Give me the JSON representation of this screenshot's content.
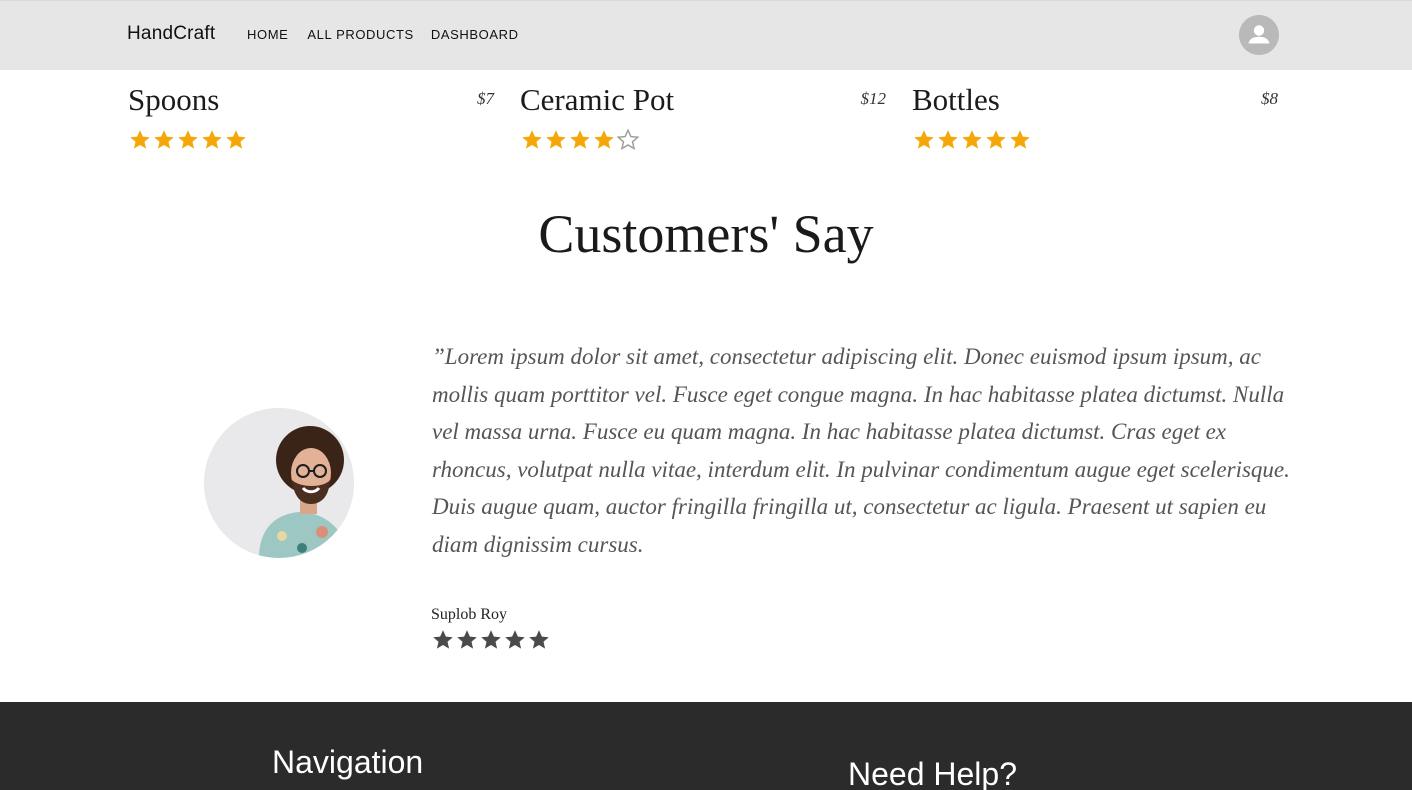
{
  "header": {
    "brand": "HandCraft",
    "nav": [
      {
        "label": "HOME"
      },
      {
        "label": "ALL PRODUCTS"
      },
      {
        "label": "DASHBOARD"
      }
    ],
    "account_icon": "account-circle-icon",
    "background": "#e6e6e6"
  },
  "products": [
    {
      "name": "Spoons",
      "price": "$7",
      "rating": 5,
      "max_rating": 5
    },
    {
      "name": "Ceramic Pot",
      "price": "$12",
      "rating": 4,
      "max_rating": 5
    },
    {
      "name": "Bottles",
      "price": "$8",
      "rating": 5,
      "max_rating": 5
    }
  ],
  "testimonials": {
    "title": "Customers' Say",
    "quote": "”Lorem ipsum dolor sit amet, consectetur adipiscing elit. Donec euismod ipsum ipsum, ac mollis quam porttitor vel. Fusce eget congue magna. In hac habitasse platea dictumst. Nulla vel massa urna. Fusce eu quam magna. In hac habitasse platea dictumst. Cras eget ex rhoncus, volutpat nulla vitae, interdum elit. In pulvinar condimentum augue eget scelerisque. Duis augue quam, auctor fringilla fringilla ut, consectetur ac ligula. Praesent ut sapien eu diam dignissim cursus.",
    "reviewer": "Suplob Roy",
    "rating": 5,
    "max_rating": 5
  },
  "footer": {
    "navigation_heading": "Navigation",
    "help_heading": "Need Help?",
    "background": "#2b2b2b"
  },
  "colors": {
    "star_filled": "#f5a70a",
    "star_empty": "#9a9a9a",
    "review_star": "#4a4a4a"
  }
}
